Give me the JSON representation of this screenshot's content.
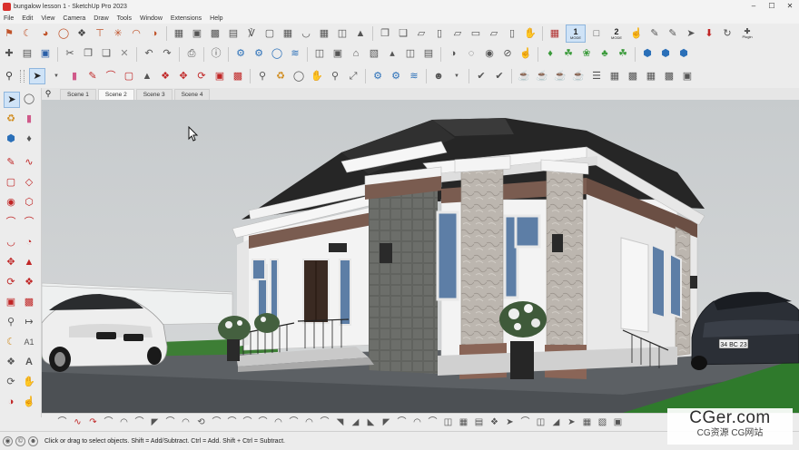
{
  "window": {
    "title": "bungalow lesson 1 - SketchUp Pro 2023"
  },
  "menu": [
    "File",
    "Edit",
    "View",
    "Camera",
    "Draw",
    "Tools",
    "Window",
    "Extensions",
    "Help"
  ],
  "toolbar_modes": [
    {
      "number": "1",
      "label": "MODE"
    },
    {
      "number": "2",
      "label": "MODE"
    }
  ],
  "toolbar_mode_plugin": "Plugin",
  "scenes": [
    "Scene 1",
    "Scene 2",
    "Scene 3",
    "Scene 4"
  ],
  "active_scene": "Scene 2",
  "car_left": {
    "plate": ""
  },
  "car_right": {
    "plate": "34 BC 23"
  },
  "status": {
    "text": "Click or drag to select objects. Shift = Add/Subtract. Ctrl = Add. Shift + Ctrl = Subtract."
  },
  "watermark": {
    "line1": "CGer.com",
    "line2": "CG资源 CG网站"
  },
  "colors": {
    "accent": "#1a73c7",
    "sky": "#cfd2d4",
    "ground": "#5f6366",
    "grass": "#2f7a2c",
    "wall": "#f2f2f2",
    "roof": "#2a2a2a",
    "trim_brown": "#7a5c50",
    "stone": "#bdb7b1"
  }
}
